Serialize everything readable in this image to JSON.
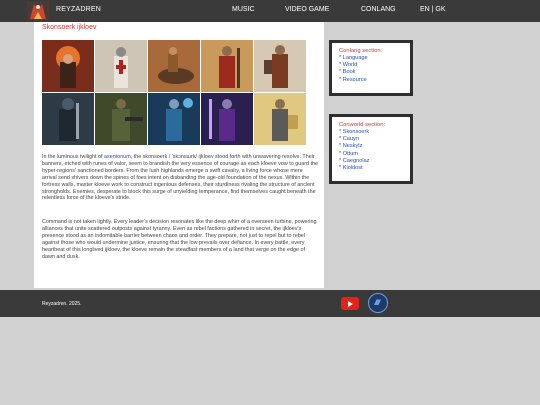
{
  "header": {
    "brand": "REYZADREN",
    "nav": [
      "MUSIC",
      "VIDEO GAME",
      "CONLANG",
      "EN | GK"
    ]
  },
  "main": {
    "title": "Skonsoerk ijkloev",
    "paragraphs": [
      {
        "before": "In the luminous twilight of ",
        "link": "asentonum",
        "after": ", the skonsoerk / 'skɔnsɯrk/ ijkloev stood forth with unwavering resolve. Their banners, etched with runes of valor, seem to brandish the very essence of courage as each kloeve vow to guard the hyper-regions' sanctioned borders. From the lush highlands emerge a swift cavalry, a living force whose mere arrival send shivers down the spines of foes intent on disbanding the age-old foundation of the nexus. Within the fortress walls, master kloeve work to construct ingenious defenses, their sturdiness rivaling the structure of ancient strongholds. Enemies, desperate to block this surge of unyielding temperance, find themselves caught beneath the relentless force of the kloeve's stride."
      },
      {
        "text": "Command is not taken lightly. Every leader's decision resonates like the deep whirr of a overseen turbine, powering alliances that unite scattered outposts against tyranny. Even as rebel factions gathered in secret, the ijkloev's presence stood as an indomitable barrier between chaos and order. They prepare, not just to repel but to rebel against those who would undermine justice, ensuring that the low prevails over defiance. In every battle, every heartbeat of this longlived ijkloev, the kloeve remain the steadfast members of a land that verge on the edge of dawn and dusk."
      }
    ]
  },
  "sidebar": {
    "conlang": {
      "title": "Conlang section:",
      "links": [
        "* Language",
        "* World",
        "* Book",
        "* Resource"
      ]
    },
    "conworld": {
      "title": "Conworld section:",
      "links": [
        "* Skonsoerk",
        "* Cauyn",
        "* Neskylz",
        "* Ottum",
        "* Caegnolaz",
        "* Kloldost"
      ]
    }
  },
  "footer": {
    "copyright": "Reyzadren. 2025."
  },
  "colors": {
    "accent_red": "#dd3333",
    "link_blue": "#2a4db8",
    "dark_bar": "#3a3a3a",
    "page_bg": "#d2d2d2"
  },
  "icons": {
    "logo": "reyzadren-logo-icon",
    "youtube": "youtube-icon",
    "site": "site-badge-icon"
  }
}
